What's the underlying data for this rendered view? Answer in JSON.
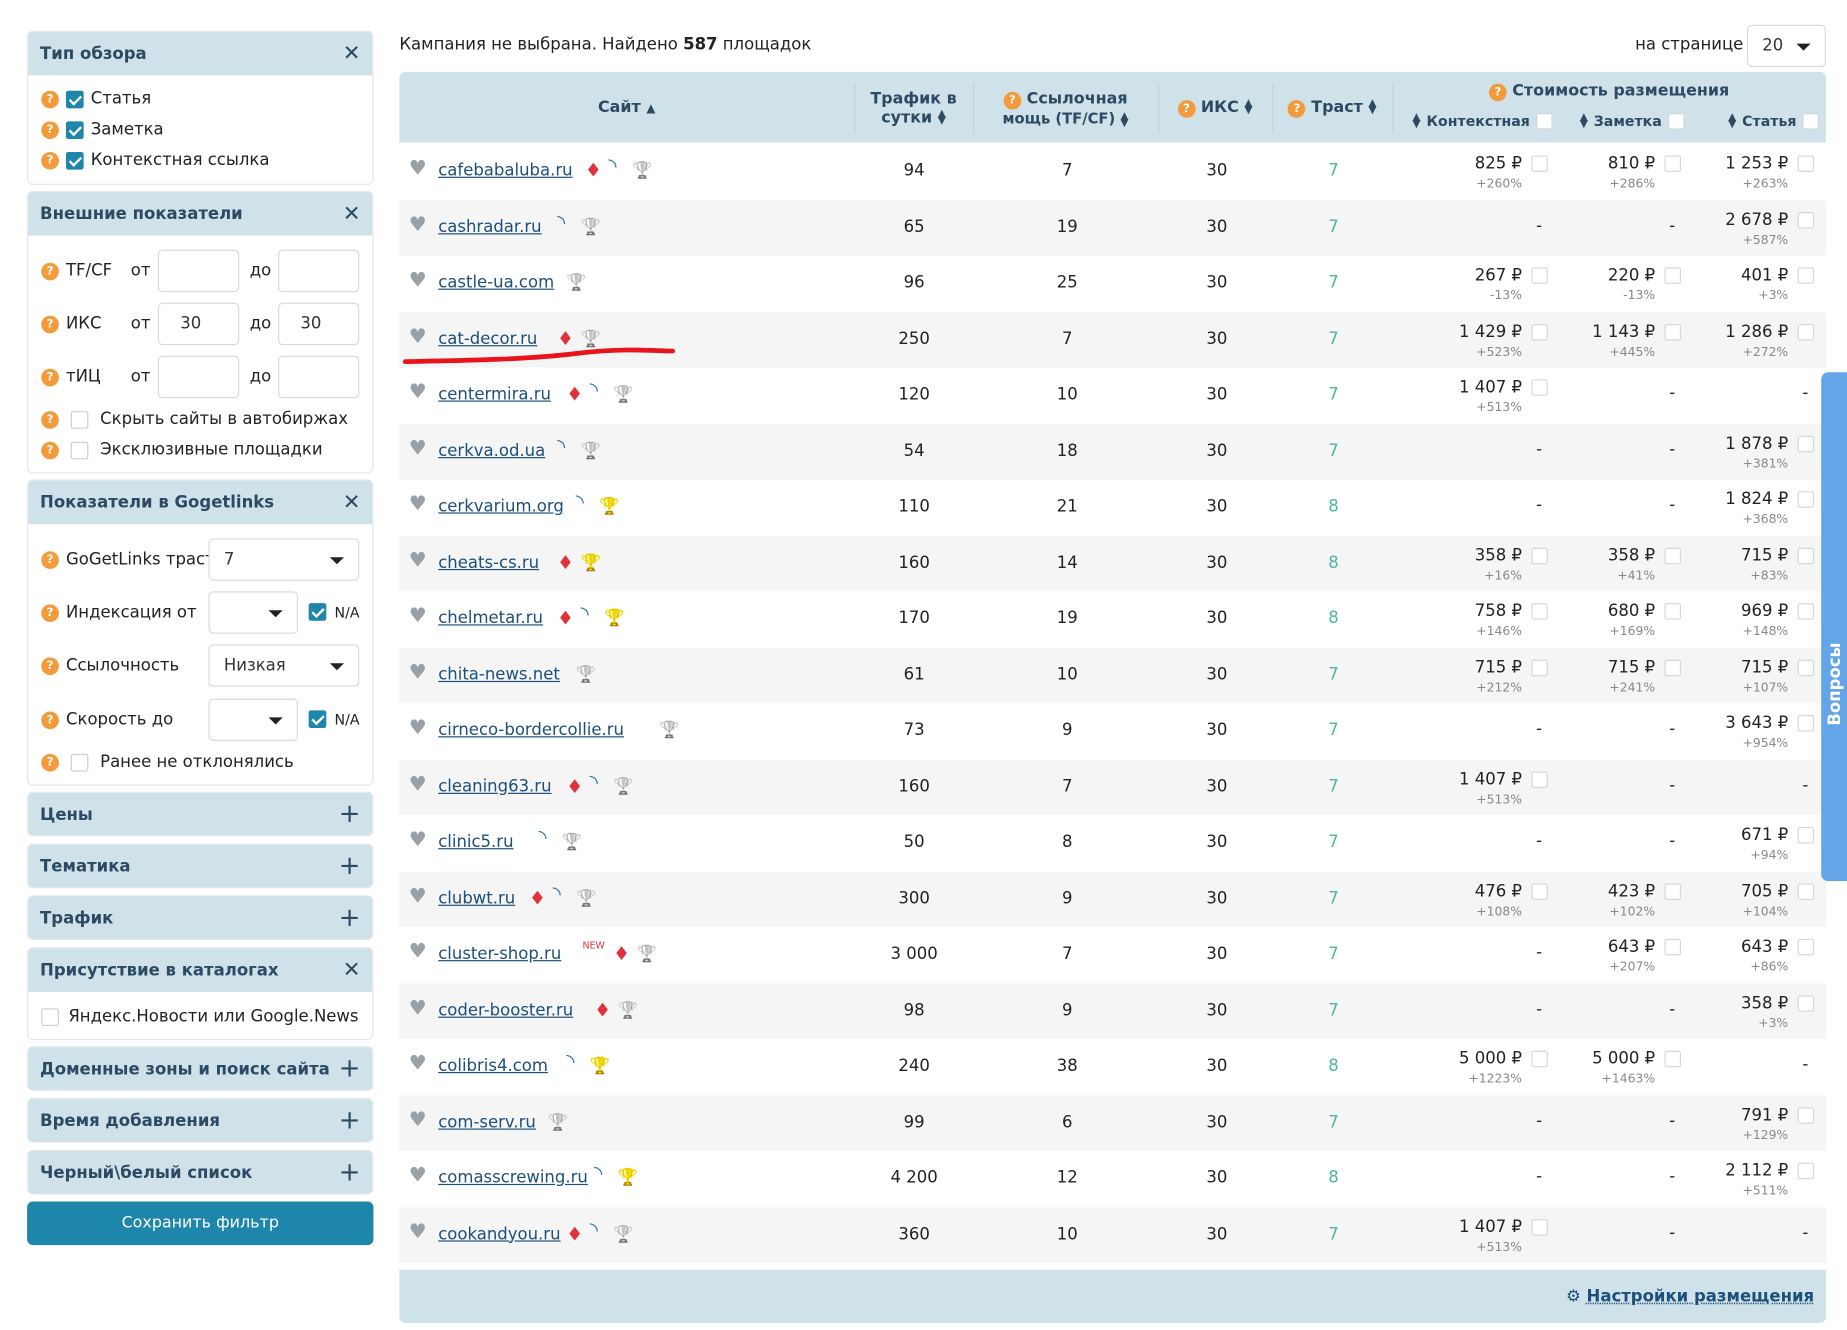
{
  "sidebar": {
    "review_type": {
      "title": "Тип обзора",
      "items": [
        {
          "label": "Статья",
          "checked": true
        },
        {
          "label": "Заметка",
          "checked": true
        },
        {
          "label": "Контекстная ссылка",
          "checked": true
        }
      ]
    },
    "external": {
      "title": "Внешние показатели",
      "from": "от",
      "to": "до",
      "rows": [
        {
          "label": "TF/CF",
          "from_value": "",
          "to_value": ""
        },
        {
          "label": "ИКС",
          "from_value": "30",
          "to_value": "30"
        },
        {
          "label": "тИЦ",
          "from_value": "",
          "to_value": ""
        }
      ],
      "hide_exchanges": "Скрыть сайты в автобиржах",
      "exclusive": "Эксклюзивные площадки"
    },
    "gogetlinks": {
      "title": "Показатели в Gogetlinks",
      "trust_label": "GoGetLinks траст",
      "trust_value": "7",
      "index_label": "Индексация от",
      "index_value": "",
      "na": "N/A",
      "links_label": "Ссылочность",
      "links_value": "Низкая",
      "speed_label": "Скорость до",
      "speed_value": "",
      "not_rejected": "Ранее не отклонялись"
    },
    "prices": "Цены",
    "topics": "Тематика",
    "traffic": "Трафик",
    "catalogs": {
      "title": "Присутствие в каталогах",
      "item": "Яндекс.Новости или Google.News"
    },
    "domains": "Доменные зоны и поиск сайта",
    "added_time": "Время добавления",
    "blackwhite": "Черный\\белый список",
    "save": "Сохранить фильтр"
  },
  "main": {
    "summary_prefix": "Кампания не выбрана. Найдено",
    "summary_count": "587",
    "summary_suffix": "площадок",
    "per_page_label": "на странице",
    "per_page_value": "20",
    "columns": {
      "site": "Сайт",
      "traffic_1": "Трафик в",
      "traffic_2": "сутки",
      "power_1": "Ссылочная",
      "power_2": "мощь (TF/CF)",
      "iks": "ИКС",
      "trust": "Траст",
      "cost": "Стоимость размещения",
      "context": "Контекстная",
      "note": "Заметка",
      "article": "Статья"
    },
    "footer_link": "Настройки размещения",
    "side_tab": "Вопросы",
    "colors": {
      "accent": "#1e86ab",
      "header_bg": "#cfe2ea",
      "trust": "#4db6a6",
      "help": "#f39a3b",
      "annotation": "#e8141b"
    },
    "rows": [
      {
        "site": "cafebabaluba.ru",
        "icons": [
          "gem",
          "rss",
          "trophy"
        ],
        "traffic": "94",
        "power": "7",
        "iks": "30",
        "trust": "7",
        "context": [
          "825 ₽",
          "+260%"
        ],
        "note": [
          "810 ₽",
          "+286%"
        ],
        "article": [
          "1 253 ₽",
          "+263%"
        ]
      },
      {
        "site": "cashradar.ru",
        "icons": [
          "rss",
          "trophy"
        ],
        "traffic": "65",
        "power": "19",
        "iks": "30",
        "trust": "7",
        "context": null,
        "note": null,
        "article": [
          "2 678 ₽",
          "+587%"
        ]
      },
      {
        "site": "castle-ua.com",
        "icons": [
          "trophy"
        ],
        "traffic": "96",
        "power": "25",
        "iks": "30",
        "trust": "7",
        "context": [
          "267 ₽",
          "-13%"
        ],
        "note": [
          "220 ₽",
          "-13%"
        ],
        "article": [
          "401 ₽",
          "+3%"
        ]
      },
      {
        "site": "cat-decor.ru",
        "icons": [
          "gem",
          "trophy"
        ],
        "traffic": "250",
        "power": "7",
        "iks": "30",
        "trust": "7",
        "context": [
          "1 429 ₽",
          "+523%"
        ],
        "note": [
          "1 143 ₽",
          "+445%"
        ],
        "article": [
          "1 286 ₽",
          "+272%"
        ]
      },
      {
        "site": "centermira.ru",
        "icons": [
          "gem",
          "rss",
          "trophy"
        ],
        "traffic": "120",
        "power": "10",
        "iks": "30",
        "trust": "7",
        "context": [
          "1 407 ₽",
          "+513%"
        ],
        "note": null,
        "article": null
      },
      {
        "site": "cerkva.od.ua",
        "icons": [
          "rss",
          "trophy"
        ],
        "traffic": "54",
        "power": "18",
        "iks": "30",
        "trust": "7",
        "context": null,
        "note": null,
        "article": [
          "1 878 ₽",
          "+381%"
        ]
      },
      {
        "site": "cerkvarium.org",
        "icons": [
          "rss",
          "trophy-gold"
        ],
        "traffic": "110",
        "power": "21",
        "iks": "30",
        "trust": "8",
        "context": null,
        "note": null,
        "article": [
          "1 824 ₽",
          "+368%"
        ]
      },
      {
        "site": "cheats-cs.ru",
        "icons": [
          "gem",
          "trophy-gold"
        ],
        "traffic": "160",
        "power": "14",
        "iks": "30",
        "trust": "8",
        "context": [
          "358 ₽",
          "+16%"
        ],
        "note": [
          "358 ₽",
          "+41%"
        ],
        "article": [
          "715 ₽",
          "+83%"
        ]
      },
      {
        "site": "chelmetar.ru",
        "icons": [
          "gem",
          "rss",
          "trophy-gold"
        ],
        "traffic": "170",
        "power": "19",
        "iks": "30",
        "trust": "8",
        "context": [
          "758 ₽",
          "+146%"
        ],
        "note": [
          "680 ₽",
          "+169%"
        ],
        "article": [
          "969 ₽",
          "+148%"
        ]
      },
      {
        "site": "chita-news.net",
        "icons": [
          "trophy"
        ],
        "traffic": "61",
        "power": "10",
        "iks": "30",
        "trust": "7",
        "context": [
          "715 ₽",
          "+212%"
        ],
        "note": [
          "715 ₽",
          "+241%"
        ],
        "article": [
          "715 ₽",
          "+107%"
        ]
      },
      {
        "site": "cirneco-bordercollie.ru",
        "icons": [
          "trophy"
        ],
        "traffic": "73",
        "power": "9",
        "iks": "30",
        "trust": "7",
        "context": null,
        "note": null,
        "article": [
          "3 643 ₽",
          "+954%"
        ]
      },
      {
        "site": "cleaning63.ru",
        "icons": [
          "gem",
          "rss",
          "trophy"
        ],
        "traffic": "160",
        "power": "7",
        "iks": "30",
        "trust": "7",
        "context": [
          "1 407 ₽",
          "+513%"
        ],
        "note": null,
        "article": null
      },
      {
        "site": "clinic5.ru",
        "icons": [
          "rss",
          "trophy"
        ],
        "traffic": "50",
        "power": "8",
        "iks": "30",
        "trust": "7",
        "context": null,
        "note": null,
        "article": [
          "671 ₽",
          "+94%"
        ]
      },
      {
        "site": "clubwt.ru",
        "icons": [
          "gem",
          "rss",
          "trophy"
        ],
        "traffic": "300",
        "power": "9",
        "iks": "30",
        "trust": "7",
        "context": [
          "476 ₽",
          "+108%"
        ],
        "note": [
          "423 ₽",
          "+102%"
        ],
        "article": [
          "705 ₽",
          "+104%"
        ]
      },
      {
        "site": "cluster-shop.ru",
        "badge": "NEW",
        "icons": [
          "gem",
          "trophy"
        ],
        "traffic": "3 000",
        "power": "7",
        "iks": "30",
        "trust": "7",
        "context": null,
        "note": [
          "643 ₽",
          "+207%"
        ],
        "article": [
          "643 ₽",
          "+86%"
        ]
      },
      {
        "site": "coder-booster.ru",
        "icons": [
          "gem",
          "trophy"
        ],
        "traffic": "98",
        "power": "9",
        "iks": "30",
        "trust": "7",
        "context": null,
        "note": null,
        "article": [
          "358 ₽",
          "+3%"
        ]
      },
      {
        "site": "colibris4.com",
        "icons": [
          "rss",
          "trophy-gold"
        ],
        "traffic": "240",
        "power": "38",
        "iks": "30",
        "trust": "8",
        "context": [
          "5 000 ₽",
          "+1223%"
        ],
        "note": [
          "5 000 ₽",
          "+1463%"
        ],
        "article": null
      },
      {
        "site": "com-serv.ru",
        "icons": [
          "trophy"
        ],
        "traffic": "99",
        "power": "6",
        "iks": "30",
        "trust": "7",
        "context": null,
        "note": null,
        "article": [
          "791 ₽",
          "+129%"
        ]
      },
      {
        "site": "comasscrewing.ru",
        "icons": [
          "rss",
          "trophy-gold"
        ],
        "traffic": "4 200",
        "power": "12",
        "iks": "30",
        "trust": "8",
        "context": null,
        "note": null,
        "article": [
          "2 112 ₽",
          "+511%"
        ]
      },
      {
        "site": "cookandyou.ru",
        "icons": [
          "gem",
          "rss",
          "trophy"
        ],
        "traffic": "360",
        "power": "10",
        "iks": "30",
        "trust": "7",
        "context": [
          "1 407 ₽",
          "+513%"
        ],
        "note": null,
        "article": null
      }
    ]
  }
}
